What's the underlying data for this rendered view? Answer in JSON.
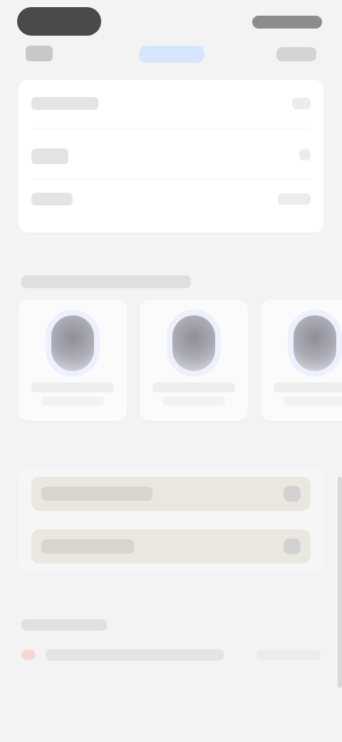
{
  "header": {
    "active_tab_label": ""
  },
  "summary": {
    "rows": [
      {
        "label": "",
        "value": ""
      },
      {
        "label": "",
        "value": ""
      },
      {
        "label": "",
        "value": ""
      }
    ]
  },
  "recommendations": {
    "title": "",
    "products": [
      {
        "name": "",
        "subtitle": ""
      },
      {
        "name": "",
        "subtitle": ""
      },
      {
        "name": "",
        "subtitle": ""
      }
    ]
  },
  "actions": {
    "items": [
      {
        "label": ""
      },
      {
        "label": ""
      }
    ]
  },
  "footer": {
    "title": "",
    "row_text": "",
    "row_meta": ""
  },
  "colors": {
    "accent": "#2f6fe0",
    "background": "#f3f3f3",
    "card": "#ffffff"
  },
  "icons": {
    "back": "chevron-left-icon",
    "actions": "more-icon",
    "row_action": "chevron-right-icon",
    "footer_dot": "status-dot-icon"
  }
}
